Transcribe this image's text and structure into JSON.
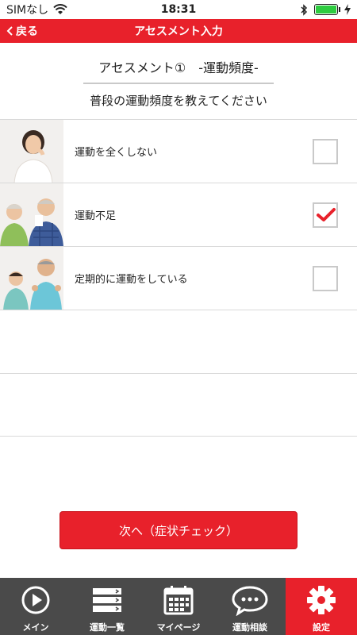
{
  "status": {
    "carrier": "SIMなし",
    "time": "18:31"
  },
  "nav": {
    "back_label": "戻る",
    "title": "アセスメント入力"
  },
  "header": {
    "title": "アセスメント①　-運動頻度-",
    "question": "普段の運動頻度を教えてください"
  },
  "options": [
    {
      "label": "運動を全くしない",
      "checked": false
    },
    {
      "label": "運動不足",
      "checked": true
    },
    {
      "label": "定期的に運動をしている",
      "checked": false
    }
  ],
  "next_button": "次へ（症状チェック）",
  "tabs": [
    {
      "label": "メイン",
      "icon": "play-icon",
      "active": false
    },
    {
      "label": "運動一覧",
      "icon": "list-icon",
      "active": false
    },
    {
      "label": "マイページ",
      "icon": "calendar-icon",
      "active": false
    },
    {
      "label": "運動相談",
      "icon": "chat-icon",
      "active": false
    },
    {
      "label": "設定",
      "icon": "gear-icon",
      "active": true
    }
  ],
  "colors": {
    "accent": "#e8212b",
    "tabbar": "#4a4a4a"
  }
}
